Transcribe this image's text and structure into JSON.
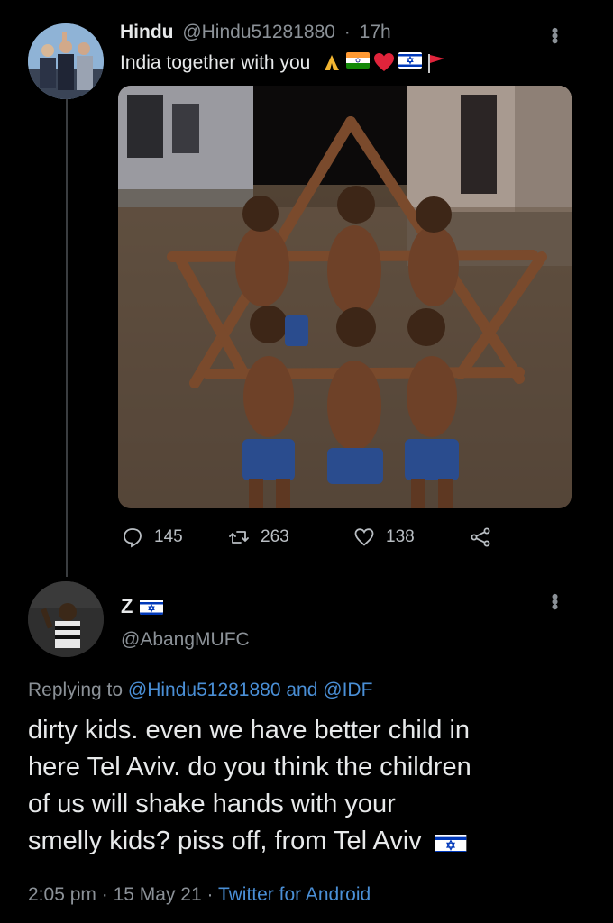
{
  "tweet1": {
    "display_name": "Hindu",
    "handle": "@Hindu51281880",
    "separator": "·",
    "time": "17h",
    "text": "India together with you",
    "emojis": [
      "folded-hands",
      "india-flag",
      "red-heart",
      "israel-flag",
      "red-flag"
    ],
    "stats": {
      "replies": "145",
      "retweets": "263",
      "likes": "138"
    }
  },
  "tweet2": {
    "display_name": "Z",
    "handle": "@AbangMUFC",
    "replying_prefix": "Replying to",
    "replying_user1": "@Hindu51281880",
    "replying_and": "and",
    "replying_user2": "@IDF",
    "text_lines": [
      "dirty kids. even we have better child in",
      "here Tel Aviv. do you think the children",
      "of us will shake hands with your",
      "smelly kids? piss off, from Tel Aviv"
    ],
    "time": "2:05 pm",
    "sep": "·",
    "date": "15 May 21",
    "source": "Twitter for Android"
  },
  "colors": {
    "background": "#000000",
    "text": "#e7e9ea",
    "muted": "#8b9197",
    "link": "#4a8fd6"
  }
}
